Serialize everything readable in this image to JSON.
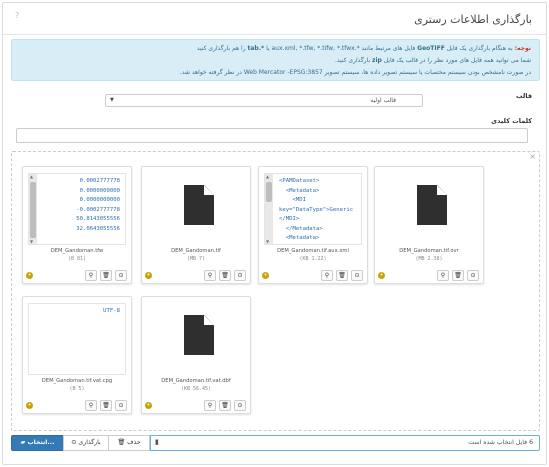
{
  "header": {
    "title": "بارگذاری اطلاعات رستری",
    "help_glyph": "?"
  },
  "alert": {
    "note_label": "نوجه:",
    "line1_a": "به هنگام بارگذاری یک فایل",
    "line1_geotiff": "GeoTIFF",
    "line1_b": "فایل های مرتبط مانند",
    "line1_exts": "*.aux.xml, *.tfw, *.tifw, *.tfwx",
    "line1_c": "یا",
    "line1_tab": "*.tab",
    "line1_d": "را هم بارگذاری کنید",
    "line2_a": "شما می توانید همه فایل های مورد نظر را در قالب یک فایل",
    "line2_zip": "zip",
    "line2_b": "بارگذاری کنید.",
    "line3": "در صورت نامشخص بودن سیستم مختصات یا سیستم تصویر داده ها، سیستم تصویر Web Mercator -EPSG:3857 در نظر گرفته خواهد شد."
  },
  "template_field": {
    "label": "قالب",
    "selected": "قالب اولیه"
  },
  "keywords_field": {
    "label": "کلمات کلیدی",
    "value": ""
  },
  "files": [
    {
      "name": "DEM_Gandoman.tfw",
      "size": "(B 81)",
      "kind": "text",
      "preview": "0.0002777778\n0.0000000000\n0.0000000000\n-0.0002777778\n50.8143055556\n32.0643055556"
    },
    {
      "name": "DEM_Gandoman.tif",
      "size": "(MB 7)",
      "kind": "icon"
    },
    {
      "name": "DEM_Gandoman.tif.aux.xml",
      "size": "(KB 1.22)",
      "kind": "text",
      "preview": "<PAMDataset>\n  <Metadata>\n    <MDI\nkey=\"DataType\">Generic\n</MDI>\n  </Metadata>\n  <Metadata>"
    },
    {
      "name": "DEM_Gandoman.tif.ovr",
      "size": "(MB 2.38)",
      "kind": "icon"
    },
    {
      "name": "DEM_Gandoman.tif.vat.cpg",
      "size": "(B 5)",
      "kind": "text",
      "preview": "UTF-8"
    },
    {
      "name": "DEM_Gandoman.tif.vat.dbf",
      "size": "(KB 56.45)",
      "kind": "icon"
    }
  ],
  "card_buttons": {
    "zoom": "⚲",
    "delete": "🗑",
    "upload": "⊙",
    "status": "+"
  },
  "bottom": {
    "caption": "6 فایل انتخاب شده است",
    "remove_label": "حذف",
    "upload_label": "بارگذاری",
    "browse_label": "انتخاب..."
  },
  "dropzone": {
    "close_glyph": "×"
  }
}
